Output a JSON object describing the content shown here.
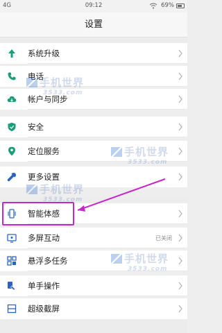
{
  "status_bar": {
    "signal": "4G",
    "time": "09:12",
    "battery": "69%"
  },
  "header": {
    "title": "设置"
  },
  "settings_items": [
    {
      "label": "系统升级",
      "icon": "arrow-up-icon",
      "color": "#1a9e7a"
    },
    {
      "label": "电话",
      "icon": "phone-icon",
      "color": "#1a9e7a"
    },
    {
      "label": "帐户与同步",
      "icon": "cloud-sync-icon",
      "color": "#1a9e7a"
    },
    {
      "label": "安全",
      "icon": "shield-icon",
      "color": "#1a9e7a"
    },
    {
      "label": "定位服务",
      "icon": "location-pin-icon",
      "color": "#1a9e7a"
    },
    {
      "label": "更多设置",
      "icon": "wrench-icon",
      "color": "#2a63c4"
    },
    {
      "label": "智能体感",
      "icon": "phone-motion-icon",
      "color": "#2a63c4"
    },
    {
      "label": "多屏互动",
      "icon": "multi-screen-icon",
      "color": "#2a63c4",
      "value": "已关闭"
    },
    {
      "label": "悬浮多任务",
      "icon": "floating-tasks-icon",
      "color": "#2a63c4"
    },
    {
      "label": "单手操作",
      "icon": "one-hand-icon",
      "color": "#2a63c4"
    },
    {
      "label": "超级截屏",
      "icon": "screenshot-icon",
      "color": "#2a63c4"
    }
  ],
  "watermark": {
    "text": "手机世界",
    "sub": "3533.com"
  },
  "colors": {
    "highlight": "#c528c9",
    "chevron": "#b0b0b0"
  }
}
